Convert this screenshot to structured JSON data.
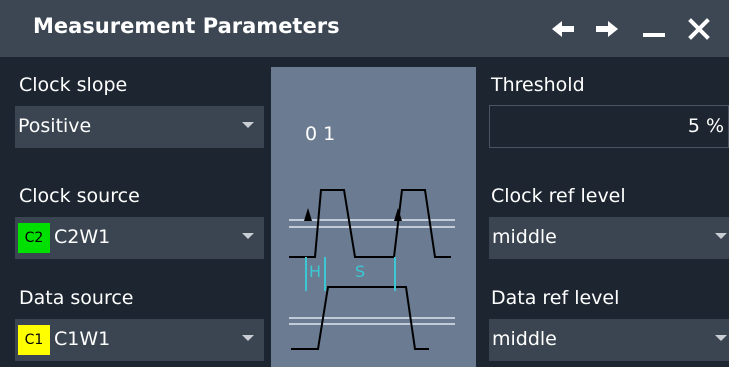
{
  "window": {
    "title": "Measurement Parameters",
    "icons": [
      "arrow-left-icon",
      "arrow-right-icon",
      "minimize-icon",
      "close-icon"
    ]
  },
  "left": {
    "clock_slope": {
      "label": "Clock slope",
      "value": "Positive"
    },
    "clock_source": {
      "label": "Clock source",
      "badge": "C2",
      "badge_color": "#00e000",
      "value": "C2W1"
    },
    "data_source": {
      "label": "Data source",
      "badge": "C1",
      "badge_color": "#ffff00",
      "value": "C1W1"
    }
  },
  "diagram": {
    "bits": "0 1",
    "hold_label": "H",
    "setup_label": "S",
    "marker_color": "#3cc8d2"
  },
  "right": {
    "threshold": {
      "label": "Threshold",
      "value": "5 %"
    },
    "clock_ref_level": {
      "label": "Clock ref level",
      "value": "middle"
    },
    "data_ref_level": {
      "label": "Data ref level",
      "value": "middle"
    }
  }
}
